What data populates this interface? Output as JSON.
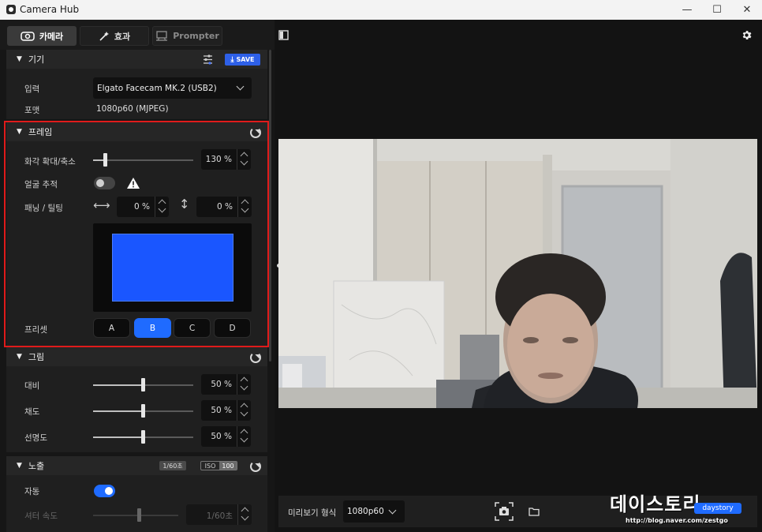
{
  "window": {
    "title": "Camera Hub",
    "minimize": "—",
    "maximize": "☐",
    "close": "✕"
  },
  "tabs": [
    {
      "label": "카메라",
      "icon": "camera-icon"
    },
    {
      "label": "효과",
      "icon": "magic-wand-icon"
    },
    {
      "label": "Prompter",
      "icon": "prompter-icon"
    }
  ],
  "device": {
    "header": "기기",
    "save_label": "SAVE",
    "input_label": "입력",
    "input_value": "Elgato Facecam MK.2 (USB2)",
    "format_label": "포맷",
    "format_value": "1080p60 (MJPEG)"
  },
  "frame": {
    "header": "프레임",
    "zoom_label": "화각 확대/축소",
    "zoom_value": "130 %",
    "zoom_level": 0.13,
    "face_tracking_label": "얼굴 추적",
    "face_tracking_on": false,
    "pan_tilt_label": "패닝 / 틸팅",
    "pan_value": "0 %",
    "tilt_value": "0 %",
    "preset_label": "프리셋",
    "presets": [
      "A",
      "B",
      "C",
      "D"
    ],
    "active_preset": "B"
  },
  "picture": {
    "header": "그림",
    "contrast_label": "대비",
    "contrast_value": "50 %",
    "saturation_label": "채도",
    "saturation_value": "50 %",
    "sharpness_label": "선명도",
    "sharpness_value": "50 %"
  },
  "exposure": {
    "header": "노출",
    "shutter_badge": "1/60초",
    "iso_label": "ISO",
    "iso_value": "100",
    "auto_label": "자동",
    "auto_on": true,
    "shutter_label": "셔터 속도",
    "shutter_value": "1/60초"
  },
  "preview_bar": {
    "format_label": "미리보기 형식",
    "format_value": "1080p60"
  },
  "watermark": {
    "title": "데이스토리",
    "url": "http://blog.naver.com/zestgo",
    "tag": "daystory"
  },
  "colors": {
    "accent": "#1f6bff",
    "highlight_border": "#e01b1b",
    "frame_preview": "#1a56ff"
  }
}
